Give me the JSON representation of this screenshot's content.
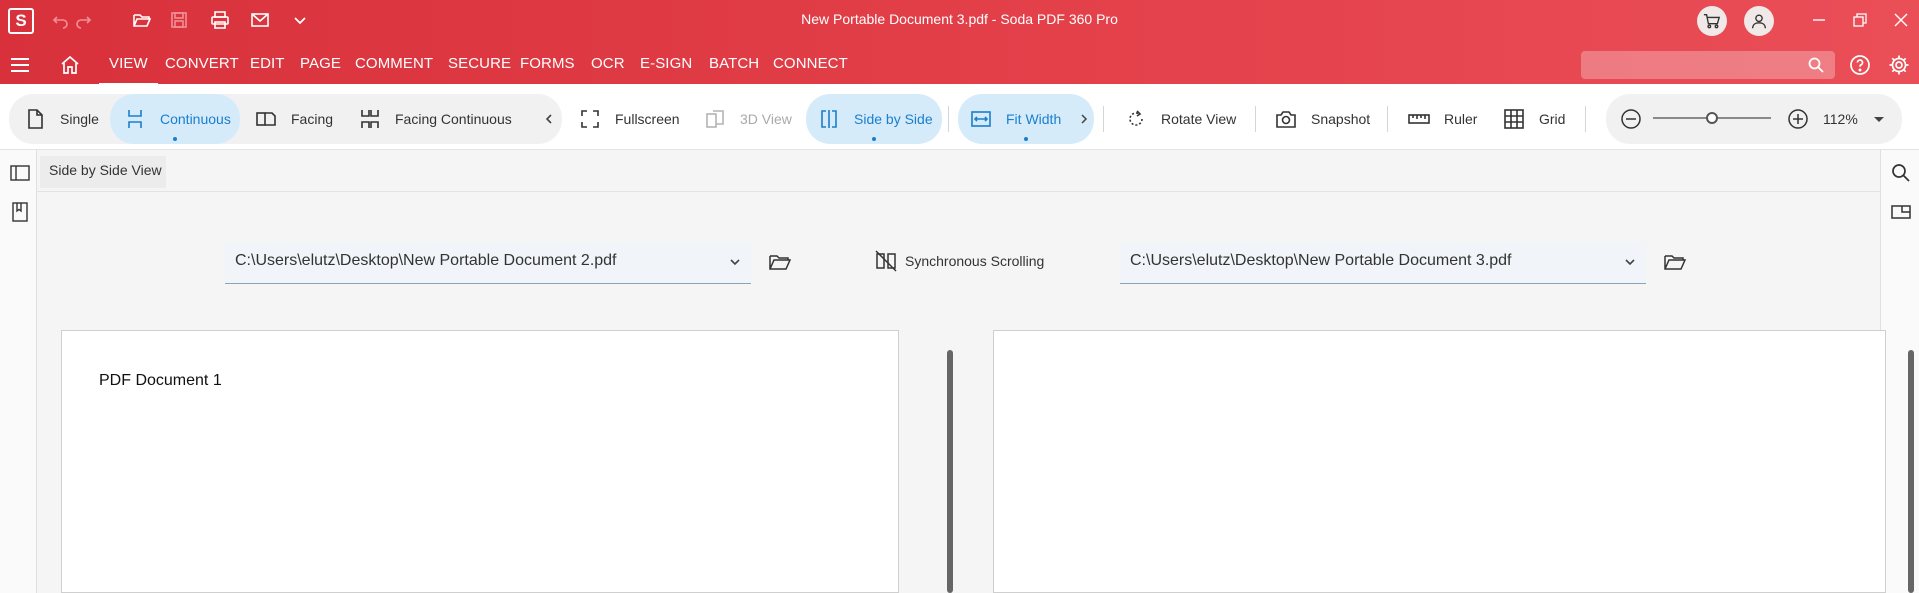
{
  "app": {
    "logo_letter": "S",
    "window_title": "New Portable Document 3.pdf   -   Soda PDF 360 Pro"
  },
  "quick_access": [
    "undo-icon",
    "redo-icon",
    "open-icon",
    "save-icon",
    "print-icon",
    "mail-icon",
    "more-icon"
  ],
  "menu": {
    "items": [
      "VIEW",
      "CONVERT",
      "EDIT",
      "PAGE",
      "COMMENT",
      "SECURE",
      "FORMS",
      "OCR",
      "E-SIGN",
      "BATCH",
      "CONNECT"
    ],
    "active": "VIEW",
    "search_placeholder": ""
  },
  "toolbar": {
    "single": "Single",
    "continuous": "Continuous",
    "facing": "Facing",
    "facing_continuous": "Facing Continuous",
    "fullscreen": "Fullscreen",
    "view_3d": "3D View",
    "side_by_side": "Side by Side",
    "fit_width": "Fit Width",
    "rotate_view": "Rotate View",
    "snapshot": "Snapshot",
    "ruler": "Ruler",
    "grid": "Grid",
    "zoom": "112%",
    "zoom_level_fraction": 0.5
  },
  "tab": {
    "label": "Side by Side View"
  },
  "compare": {
    "left_path": "C:\\Users\\elutz\\Desktop\\New Portable Document 2.pdf",
    "right_path": "C:\\Users\\elutz\\Desktop\\New Portable Document 3.pdf",
    "sync_label": "Synchronous Scrolling",
    "left_page_text": "PDF Document 1"
  },
  "colors": {
    "brand_red": "#e03c46",
    "selected_blue": "#1a7fce",
    "selected_bg": "#d6ebfa"
  }
}
